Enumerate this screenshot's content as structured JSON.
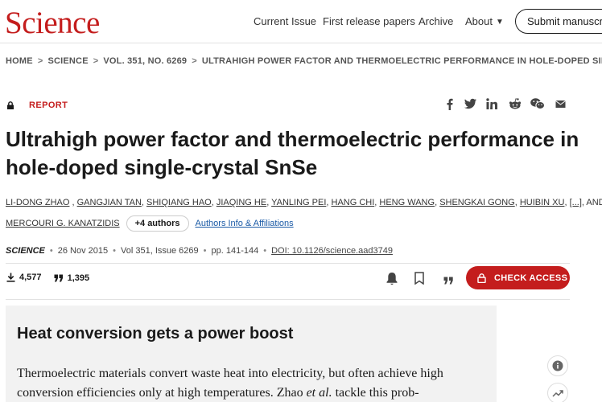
{
  "header": {
    "logo": "Science",
    "nav": [
      "Current Issue",
      "First release papers",
      "Archive",
      "About"
    ],
    "submit_label": "Submit manuscript"
  },
  "breadcrumb": [
    "HOME",
    "SCIENCE",
    "VOL. 351, NO. 6269",
    "ULTRAHIGH POWER FACTOR AND THERMOELECTRIC PERFORMANCE IN HOLE-DOPED SINGL..."
  ],
  "article": {
    "type_label": "REPORT",
    "title": "Ultrahigh power factor and thermoelectric performance in hole-doped single-crystal SnSe",
    "authors": [
      "LI-DONG ZHAO",
      "GANGJIAN TAN",
      "SHIQIANG HAO",
      "JIAQING HE",
      "YANLING PEI",
      "HANG CHI",
      "HENG WANG",
      "SHENGKAI GONG",
      "HUIBIN XU",
      "[...]"
    ],
    "authors_tail": "AND",
    "last_author": "MERCOURI G. KANATZIDIS",
    "more_authors": "+4 authors",
    "affiliations_link": "Authors Info & Affiliations",
    "journal": "SCIENCE",
    "date": "26 Nov 2015",
    "volume": "Vol 351, Issue 6269",
    "pages": "pp. 141-144",
    "doi": "DOI: 10.1126/science.aad3749",
    "downloads": "4,577",
    "citations": "1,395",
    "access_label": "CHECK ACCESS"
  },
  "summary": {
    "heading": "Heat conversion gets a power boost",
    "text_before": "Thermoelectric materials convert waste heat into electricity, but often achieve high conversion efficiencies only at high temperatures. Zhao ",
    "text_italic": "et al.",
    "text_after": " tackle this prob-"
  },
  "colors": {
    "brand": "#c41d1d",
    "link": "#1a5aa6",
    "summary_bg": "#f2f2f2"
  },
  "icons": {
    "share": [
      "facebook-icon",
      "twitter-icon",
      "linkedin-icon",
      "reddit-icon",
      "wechat-icon",
      "email-icon"
    ],
    "actions": [
      "bell-icon",
      "bookmark-icon",
      "quote-icon"
    ],
    "side": [
      "info-icon",
      "trend-icon"
    ]
  }
}
